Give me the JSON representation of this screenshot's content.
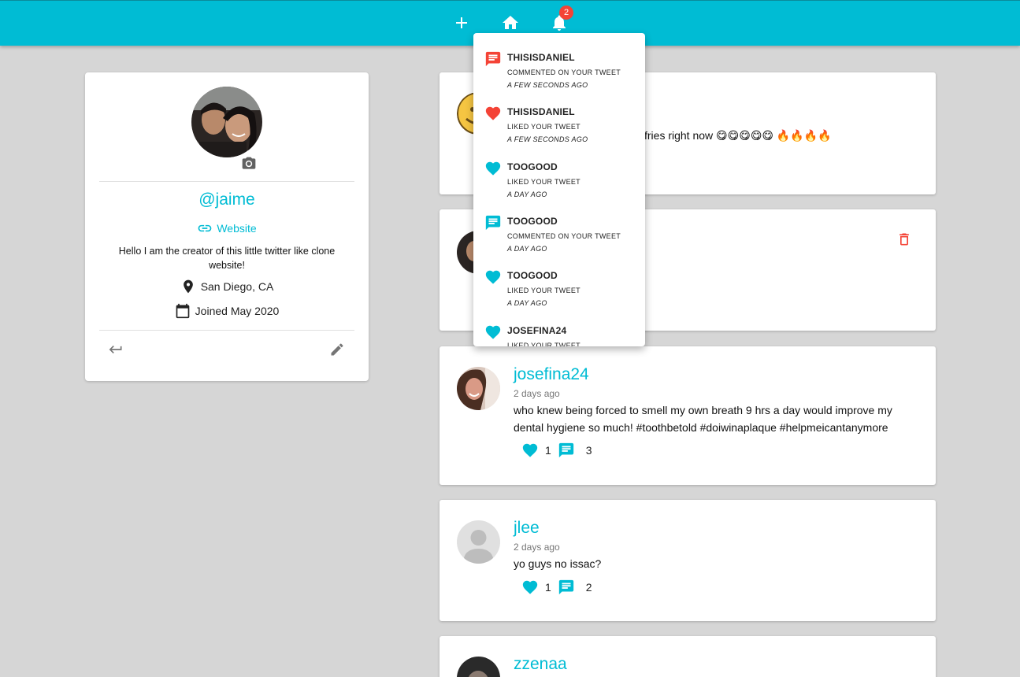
{
  "colors": {
    "primary": "#00bcd4",
    "danger": "#f44336",
    "background": "#d6d6d6"
  },
  "appbar": {
    "icons": [
      "add-icon",
      "home-icon",
      "notifications-icon"
    ],
    "notification_count": "2"
  },
  "profile": {
    "handle": "@jaime",
    "website_label": "Website",
    "bio": "Hello I am the creator of this little twitter like clone website!",
    "location": "San Diego, CA",
    "joined": "Joined May 2020"
  },
  "notifications": [
    {
      "user": "THISISDANIEL",
      "action": "COMMENTED ON YOUR TWEET",
      "time": "A FEW SECONDS AGO",
      "type": "comment",
      "read": false
    },
    {
      "user": "THISISDANIEL",
      "action": "LIKED YOUR TWEET",
      "time": "A FEW SECONDS AGO",
      "type": "like",
      "read": false
    },
    {
      "user": "TOOGOOD",
      "action": "LIKED YOUR TWEET",
      "time": "A DAY AGO",
      "type": "like",
      "read": true
    },
    {
      "user": "TOOGOOD",
      "action": "COMMENTED ON YOUR TWEET",
      "time": "A DAY AGO",
      "type": "comment",
      "read": true
    },
    {
      "user": "TOOGOOD",
      "action": "LIKED YOUR TWEET",
      "time": "A DAY AGO",
      "type": "like",
      "read": true
    },
    {
      "user": "JOSEFINA24",
      "action": "LIKED YOUR TWEET",
      "time": "",
      "type": "like",
      "read": true
    }
  ],
  "tweets": [
    {
      "body": "fries right now 😋😋😋😋😋 🔥🔥🔥🔥"
    },
    {
      "deletable": true
    },
    {
      "username": "josefina24",
      "time": "2 days ago",
      "body": "who knew being forced to smell my own breath 9 hrs a day would improve my dental hygiene so much! #toothbetold #doiwinaplaque #helpmeicantanymore",
      "likes": "1",
      "comments": "3"
    },
    {
      "username": "jlee",
      "time": "2 days ago",
      "body": "yo guys no issac?",
      "likes": "1",
      "comments": "2"
    },
    {
      "username": "zzenaa"
    }
  ]
}
